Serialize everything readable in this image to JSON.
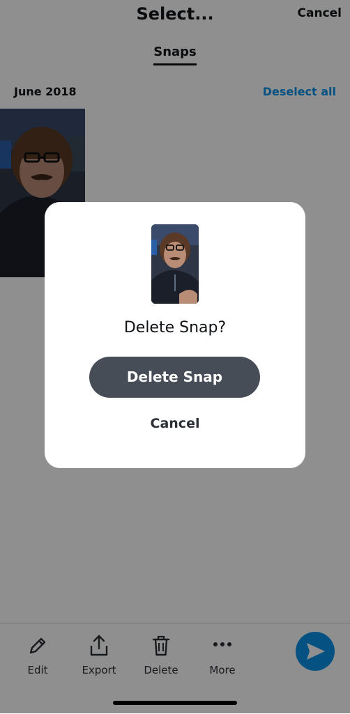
{
  "header": {
    "title": "Select...",
    "cancel_label": "Cancel"
  },
  "tabs": [
    {
      "label": "Snaps",
      "active": true
    }
  ],
  "section": {
    "date": "June 2018",
    "deselect_label": "Deselect all"
  },
  "toolbar": {
    "items": [
      {
        "label": "Edit",
        "icon": "pencil-icon"
      },
      {
        "label": "Export",
        "icon": "share-upload-icon"
      },
      {
        "label": "Delete",
        "icon": "trash-icon"
      },
      {
        "label": "More",
        "icon": "more-dots-icon"
      }
    ],
    "send_icon": "send-arrow-icon"
  },
  "dialog": {
    "question": "Delete Snap?",
    "confirm_label": "Delete Snap",
    "cancel_label": "Cancel"
  },
  "colors": {
    "accent": "#0a93e8",
    "primary_button": "#474d57",
    "overlay": "rgba(0,0,0,0.44)"
  }
}
